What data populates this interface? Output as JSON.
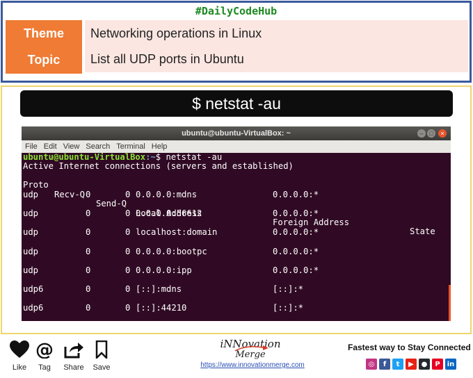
{
  "header": {
    "hashtag": "#DailyCodeHub",
    "rows": [
      {
        "label": "Theme",
        "value": "Networking operations in Linux"
      },
      {
        "label": "Topic",
        "value": "List all UDP ports in Ubuntu"
      }
    ]
  },
  "command_banner": "$ netstat -au",
  "terminal": {
    "title": "ubuntu@ubuntu-VirtualBox: ~",
    "menu": [
      "File",
      "Edit",
      "View",
      "Search",
      "Terminal",
      "Help"
    ],
    "prompt_user": "ubuntu@ubuntu-VirtualBox",
    "prompt_path": ":~",
    "prompt_cmd": "$ netstat -au",
    "status_line": "Active Internet connections (servers and established)",
    "columns": {
      "proto": "Proto",
      "recv": "Recv-Q",
      "send": "Send-Q",
      "local": "Local Address",
      "foreign": "Foreign Address",
      "state": "State"
    },
    "rows": [
      {
        "proto": "udp",
        "recv": "0",
        "send": "0",
        "local": "0.0.0.0:mdns",
        "foreign": "0.0.0.0:*"
      },
      {
        "proto": "udp",
        "recv": "0",
        "send": "0",
        "local": "0.0.0.0:56612",
        "foreign": "0.0.0.0:*"
      },
      {
        "proto": "udp",
        "recv": "0",
        "send": "0",
        "local": "localhost:domain",
        "foreign": "0.0.0.0:*"
      },
      {
        "proto": "udp",
        "recv": "0",
        "send": "0",
        "local": "0.0.0.0:bootpc",
        "foreign": "0.0.0.0:*"
      },
      {
        "proto": "udp",
        "recv": "0",
        "send": "0",
        "local": "0.0.0.0:ipp",
        "foreign": "0.0.0.0:*"
      },
      {
        "proto": "udp6",
        "recv": "0",
        "send": "0",
        "local": "[::]:mdns",
        "foreign": "[::]:*"
      },
      {
        "proto": "udp6",
        "recv": "0",
        "send": "0",
        "local": "[::]:44210",
        "foreign": "[::]:*"
      }
    ]
  },
  "footer": {
    "actions": [
      {
        "label": "Like",
        "icon": "heart-icon"
      },
      {
        "label": "Tag",
        "icon": "at-icon"
      },
      {
        "label": "Share",
        "icon": "share-icon"
      },
      {
        "label": "Save",
        "icon": "bookmark-icon"
      }
    ],
    "brand_line1": "iNNovation",
    "brand_line2": "Merge",
    "url": "https://www.innovationmerge.com",
    "tagline": "Fastest way to Stay Connected",
    "socials": [
      {
        "name": "instagram-icon",
        "glyph": "◎",
        "color": "#c13584"
      },
      {
        "name": "facebook-icon",
        "glyph": "f",
        "color": "#3b5998"
      },
      {
        "name": "twitter-icon",
        "glyph": "t",
        "color": "#1da1f2"
      },
      {
        "name": "youtube-icon",
        "glyph": "▶",
        "color": "#e62117"
      },
      {
        "name": "github-icon",
        "glyph": "●",
        "color": "#24292e"
      },
      {
        "name": "pinterest-icon",
        "glyph": "P",
        "color": "#e60023"
      },
      {
        "name": "linkedin-icon",
        "glyph": "in",
        "color": "#0a66c2"
      }
    ]
  },
  "colors": {
    "accent_orange": "#ef7b34",
    "header_border": "#3b5a9d",
    "main_border": "#efd56b",
    "terminal_bg": "#300a24",
    "hashtag_green": "#1d8a22"
  }
}
